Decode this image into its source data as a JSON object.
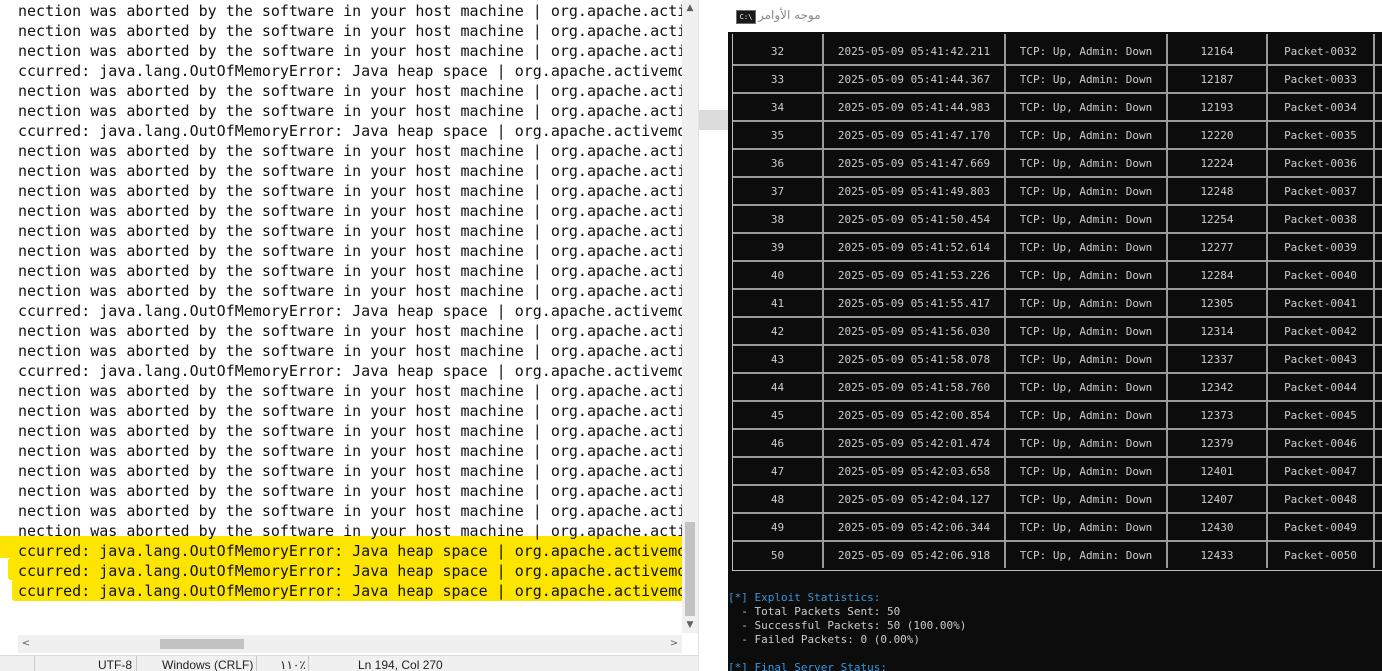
{
  "editor": {
    "line_texts": {
      "aborted": "nection was aborted by the software in your host machine | org.apache.acti",
      "oom": "ccurred: java.lang.OutOfMemoryError: Java heap space | org.apache.activemq"
    },
    "visible_lines": [
      "aborted",
      "aborted",
      "aborted",
      "oom",
      "aborted",
      "aborted",
      "oom",
      "aborted",
      "aborted",
      "aborted",
      "aborted",
      "aborted",
      "aborted",
      "aborted",
      "aborted",
      "oom",
      "aborted",
      "aborted",
      "oom",
      "aborted",
      "aborted",
      "aborted",
      "aborted",
      "aborted",
      "aborted",
      "aborted",
      "aborted",
      "oom",
      "oom",
      "oom"
    ],
    "highlighted_line_indexes": [
      27,
      28,
      29
    ],
    "highlight_color": "#fde500",
    "status": {
      "encoding": "UTF-8",
      "line_ending": "Windows (CRLF)",
      "zoom": "١١٠٪",
      "position": "Ln 194, Col 270"
    },
    "icons": {
      "scroll_up": "▲",
      "scroll_down": "▼",
      "scroll_left": "<",
      "scroll_right": ">"
    }
  },
  "console": {
    "window_title": "موجه الأوامر",
    "icon_label": "C:\\",
    "table": {
      "rows": [
        {
          "num": "32",
          "time": "2025-05-09 05:41:42.211",
          "status": "TCP: Up, Admin: Down",
          "port": "12164",
          "packet": "Packet-0032"
        },
        {
          "num": "33",
          "time": "2025-05-09 05:41:44.367",
          "status": "TCP: Up, Admin: Down",
          "port": "12187",
          "packet": "Packet-0033"
        },
        {
          "num": "34",
          "time": "2025-05-09 05:41:44.983",
          "status": "TCP: Up, Admin: Down",
          "port": "12193",
          "packet": "Packet-0034"
        },
        {
          "num": "35",
          "time": "2025-05-09 05:41:47.170",
          "status": "TCP: Up, Admin: Down",
          "port": "12220",
          "packet": "Packet-0035"
        },
        {
          "num": "36",
          "time": "2025-05-09 05:41:47.669",
          "status": "TCP: Up, Admin: Down",
          "port": "12224",
          "packet": "Packet-0036"
        },
        {
          "num": "37",
          "time": "2025-05-09 05:41:49.803",
          "status": "TCP: Up, Admin: Down",
          "port": "12248",
          "packet": "Packet-0037"
        },
        {
          "num": "38",
          "time": "2025-05-09 05:41:50.454",
          "status": "TCP: Up, Admin: Down",
          "port": "12254",
          "packet": "Packet-0038"
        },
        {
          "num": "39",
          "time": "2025-05-09 05:41:52.614",
          "status": "TCP: Up, Admin: Down",
          "port": "12277",
          "packet": "Packet-0039"
        },
        {
          "num": "40",
          "time": "2025-05-09 05:41:53.226",
          "status": "TCP: Up, Admin: Down",
          "port": "12284",
          "packet": "Packet-0040"
        },
        {
          "num": "41",
          "time": "2025-05-09 05:41:55.417",
          "status": "TCP: Up, Admin: Down",
          "port": "12305",
          "packet": "Packet-0041"
        },
        {
          "num": "42",
          "time": "2025-05-09 05:41:56.030",
          "status": "TCP: Up, Admin: Down",
          "port": "12314",
          "packet": "Packet-0042"
        },
        {
          "num": "43",
          "time": "2025-05-09 05:41:58.078",
          "status": "TCP: Up, Admin: Down",
          "port": "12337",
          "packet": "Packet-0043"
        },
        {
          "num": "44",
          "time": "2025-05-09 05:41:58.760",
          "status": "TCP: Up, Admin: Down",
          "port": "12342",
          "packet": "Packet-0044"
        },
        {
          "num": "45",
          "time": "2025-05-09 05:42:00.854",
          "status": "TCP: Up, Admin: Down",
          "port": "12373",
          "packet": "Packet-0045"
        },
        {
          "num": "46",
          "time": "2025-05-09 05:42:01.474",
          "status": "TCP: Up, Admin: Down",
          "port": "12379",
          "packet": "Packet-0046"
        },
        {
          "num": "47",
          "time": "2025-05-09 05:42:03.658",
          "status": "TCP: Up, Admin: Down",
          "port": "12401",
          "packet": "Packet-0047"
        },
        {
          "num": "48",
          "time": "2025-05-09 05:42:04.127",
          "status": "TCP: Up, Admin: Down",
          "port": "12407",
          "packet": "Packet-0048"
        },
        {
          "num": "49",
          "time": "2025-05-09 05:42:06.344",
          "status": "TCP: Up, Admin: Down",
          "port": "12430",
          "packet": "Packet-0049"
        },
        {
          "num": "50",
          "time": "2025-05-09 05:42:06.918",
          "status": "TCP: Up, Admin: Down",
          "port": "12433",
          "packet": "Packet-0050"
        }
      ]
    },
    "stats": {
      "heading": "[*] Exploit Statistics:",
      "lines": [
        "  - Total Packets Sent: 50",
        "  - Successful Packets: 50 (100.00%)",
        "  - Failed Packets: 0 (0.00%)"
      ],
      "next_heading": "[*] Final Server Status:"
    }
  }
}
